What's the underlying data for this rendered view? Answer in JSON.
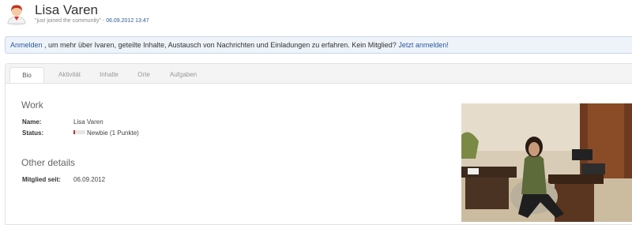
{
  "profile": {
    "name": "Lisa Varen",
    "tagline": "\"just joined the community\"",
    "separator": " - ",
    "joined_datetime": "06.09.2012 13:47"
  },
  "notice": {
    "login_link": "Anmelden",
    "text": " , um mehr über Ivaren, geteilte Inhalte, Austausch von Nachrichten und Einladungen zu erfahren. Kein Mitglied? ",
    "register_link": "Jetzt anmelden!"
  },
  "tabs": [
    {
      "label": "Bio",
      "active": true
    },
    {
      "label": "Aktivität",
      "active": false
    },
    {
      "label": "Inhalte",
      "active": false
    },
    {
      "label": "Orte",
      "active": false
    },
    {
      "label": "Aufgaben",
      "active": false
    }
  ],
  "work": {
    "title": "Work",
    "name_label": "Name:",
    "name_value": "Lisa Varen",
    "status_label": "Status:",
    "status_value": "Newbie (1 Punkte)",
    "status_level": 0.15
  },
  "other": {
    "title": "Other details",
    "member_since_label": "Mitglied seit:",
    "member_since_value": "06.09.2012"
  },
  "icons": {
    "avatar": "user-avatar-icon"
  },
  "colors": {
    "link": "#2a5a9a",
    "notice_bg": "#eef3fa",
    "status_fill": "#c03030"
  }
}
